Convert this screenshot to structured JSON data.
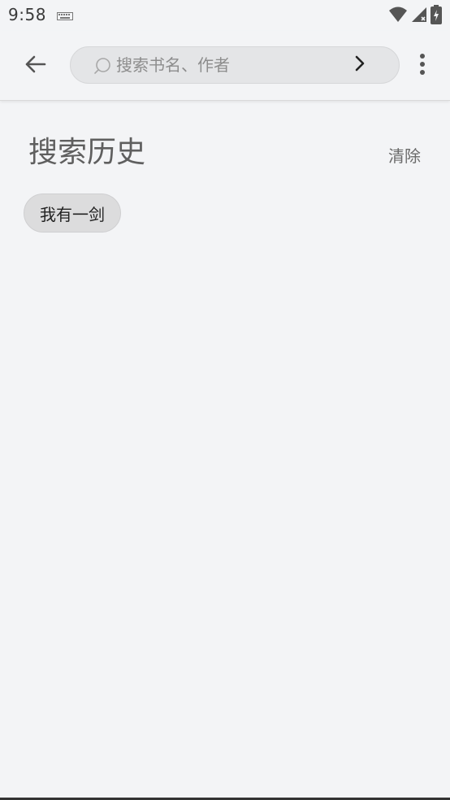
{
  "status_bar": {
    "time": "9:58"
  },
  "search": {
    "placeholder": "搜索书名、作者",
    "value": ""
  },
  "history": {
    "title": "搜索历史",
    "clear_label": "清除",
    "items": [
      {
        "label": "我有一剑"
      }
    ]
  },
  "colors": {
    "background": "#f3f4f6",
    "chip_bg": "#dcdcdd",
    "search_bg": "#e4e5e7"
  },
  "icons": {
    "back": "arrow-left-icon",
    "search": "search-icon",
    "submit": "chevron-right-icon",
    "more": "more-vert-icon"
  }
}
